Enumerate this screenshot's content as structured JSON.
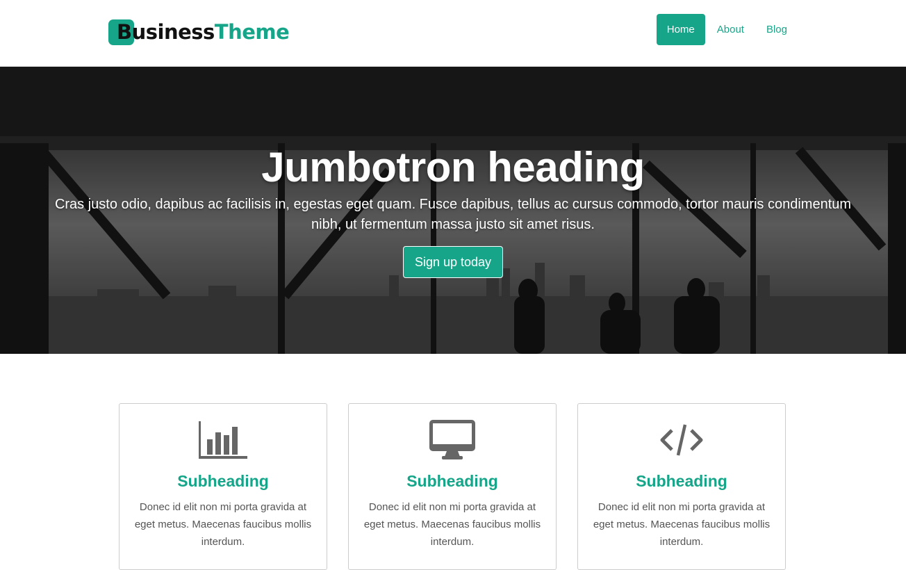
{
  "brand": {
    "part1": "Business",
    "part2": "Theme"
  },
  "nav": {
    "items": [
      {
        "label": "Home",
        "active": true
      },
      {
        "label": "About",
        "active": false
      },
      {
        "label": "Blog",
        "active": false
      }
    ]
  },
  "jumbotron": {
    "heading": "Jumbotron heading",
    "lead": "Cras justo odio, dapibus ac facilisis in, egestas eget quam. Fusce dapibus, tellus ac cursus commodo, tortor mauris condimentum nibh, ut fermentum massa justo sit amet risus.",
    "button": "Sign up today"
  },
  "features": [
    {
      "icon": "bar-chart-icon",
      "heading": "Subheading",
      "text": "Donec id elit non mi porta gravida at eget metus. Maecenas faucibus mollis interdum."
    },
    {
      "icon": "desktop-monitor-icon",
      "heading": "Subheading",
      "text": "Donec id elit non mi porta gravida at eget metus. Maecenas faucibus mollis interdum."
    },
    {
      "icon": "code-icon",
      "heading": "Subheading",
      "text": "Donec id elit non mi porta gravida at eget metus. Maecenas faucibus mollis interdum."
    }
  ],
  "colors": {
    "accent": "#16a589",
    "icon": "#666666",
    "text": "#555555"
  }
}
